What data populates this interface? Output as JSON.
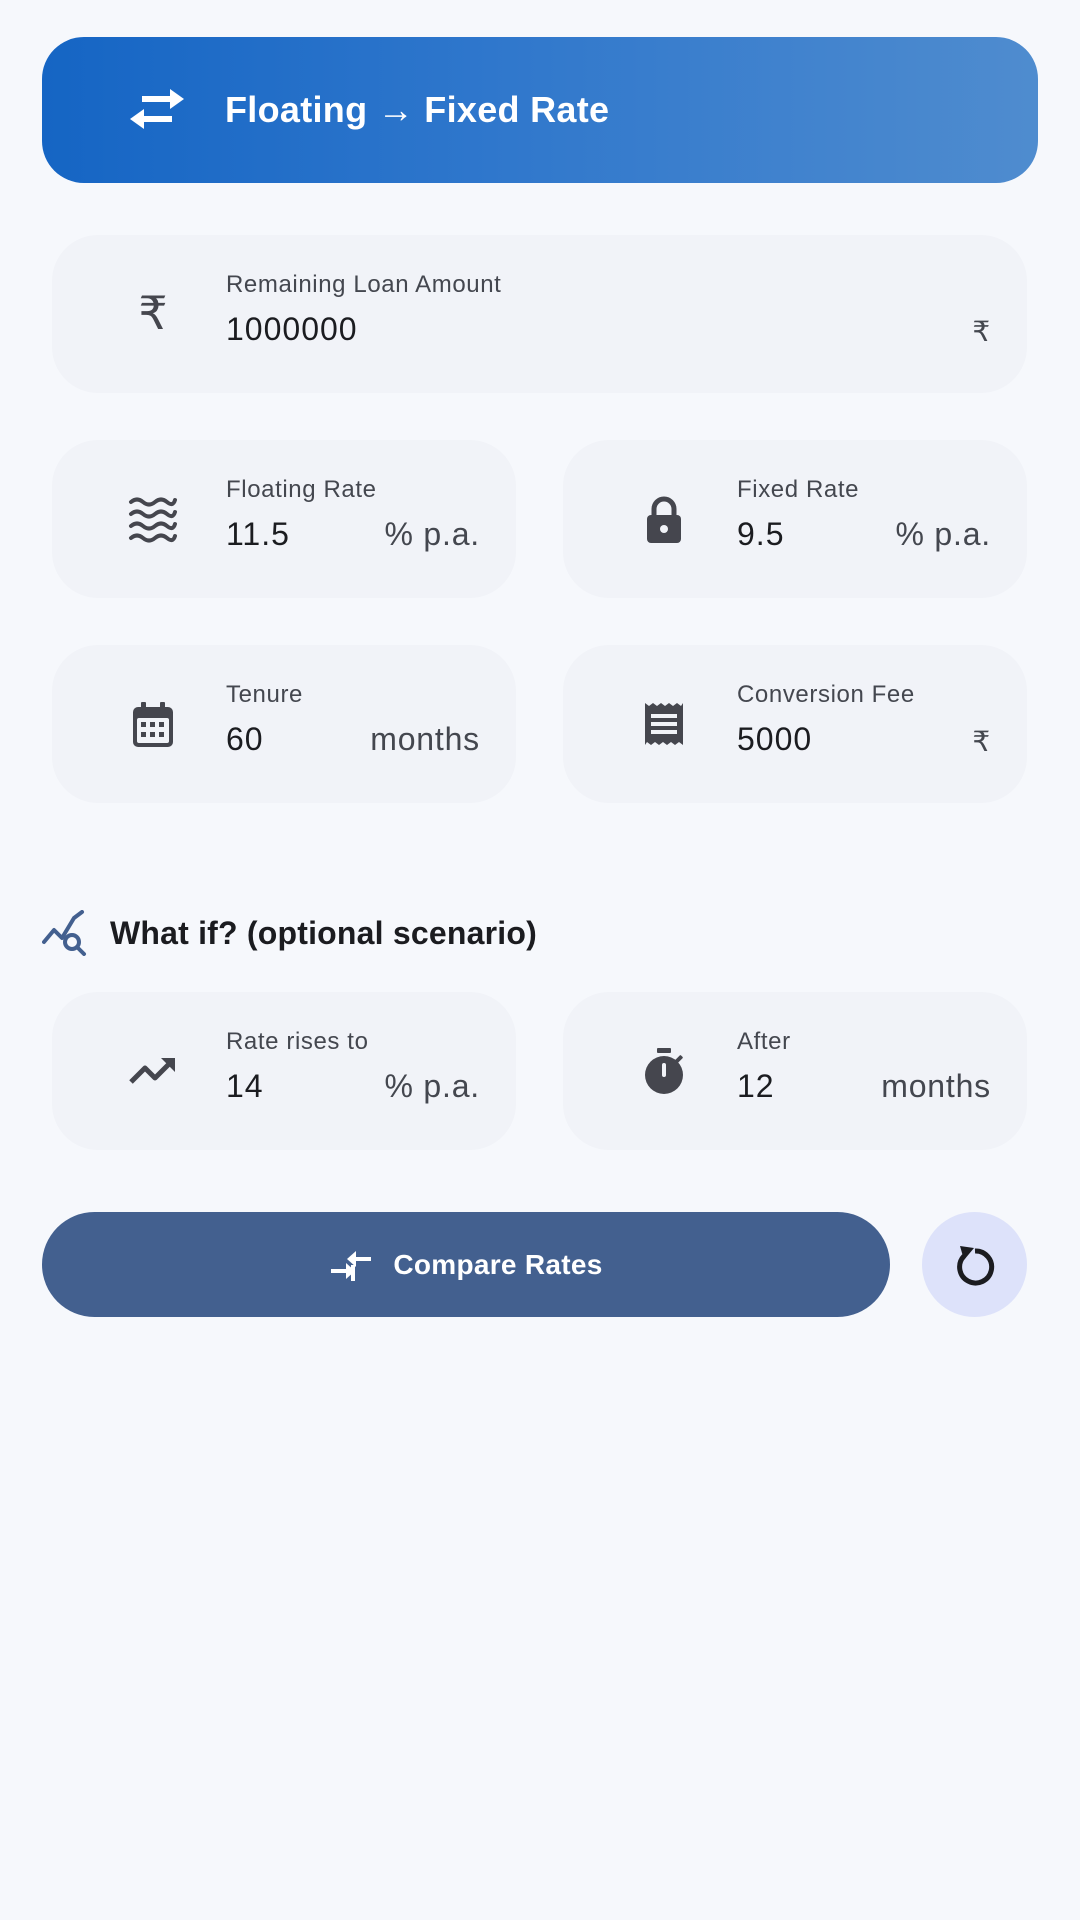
{
  "header": {
    "title": "Floating → Fixed Rate",
    "icon": "swap-horizontal-icon"
  },
  "fields": {
    "loan": {
      "label": "Remaining Loan Amount",
      "value": "1000000",
      "suffix": "₹",
      "icon": "rupee-icon"
    },
    "floating": {
      "label": "Floating Rate",
      "value": "11.5",
      "suffix": "% p.a.",
      "icon": "waves-icon"
    },
    "fixed": {
      "label": "Fixed Rate",
      "value": "9.5",
      "suffix": "% p.a.",
      "icon": "lock-icon"
    },
    "tenure": {
      "label": "Tenure",
      "value": "60",
      "suffix": "months",
      "icon": "calendar-icon"
    },
    "fee": {
      "label": "Conversion Fee",
      "value": "5000",
      "suffix": "₹",
      "icon": "receipt-icon"
    }
  },
  "scenario": {
    "title": "What if? (optional scenario)",
    "icon": "chart-search-icon",
    "rate_rise": {
      "label": "Rate rises to",
      "value": "14",
      "suffix": "% p.a.",
      "icon": "trending-up-icon"
    },
    "after": {
      "label": "After",
      "value": "12",
      "suffix": "months",
      "icon": "timer-icon"
    }
  },
  "actions": {
    "compare_label": "Compare Rates",
    "compare_icon": "compare-arrows-icon",
    "reset_icon": "reset-icon"
  },
  "colors": {
    "header_start": "#1565c4",
    "header_end": "#4f8ccf",
    "button": "#43608f",
    "reset_bg": "#dde2fa",
    "card_bg": "#f1f3f8",
    "page_bg": "#f6f8fc"
  }
}
